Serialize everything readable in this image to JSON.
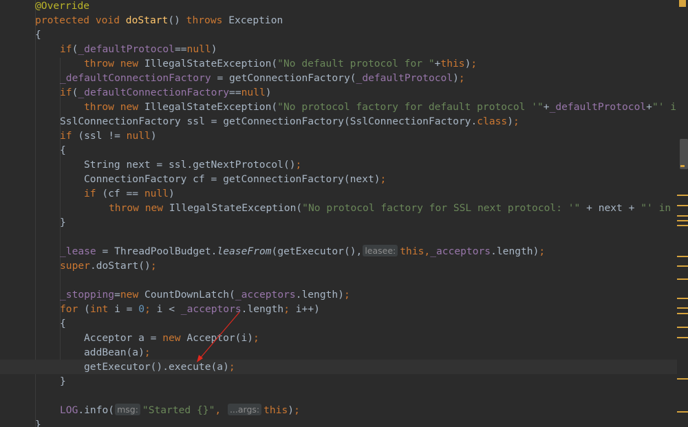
{
  "editor": {
    "lines": {
      "l1": {
        "annotation": "@Override"
      },
      "l2": {
        "kw1": "protected void ",
        "method": "doStart",
        "paren": "() ",
        "kw2": "throws ",
        "rest": "Exception"
      },
      "l3": {
        "text": "{"
      },
      "l4": {
        "kw": "if",
        "a": "(",
        "field": "_defaultProtocol",
        "b": "==",
        "kw2": "null",
        "c": ")"
      },
      "l5": {
        "kw": "throw new ",
        "a": "IllegalStateException(",
        "str": "\"No default protocol for \"",
        "b": "+",
        "kw2": "this",
        "c": ")",
        "semi": ";"
      },
      "l6": {
        "field": "_defaultConnectionFactory",
        "a": " = getConnectionFactory(",
        "field2": "_defaultProtocol",
        "b": ")",
        "semi": ";"
      },
      "l7": {
        "kw": "if",
        "a": "(",
        "field": "_defaultConnectionFactory",
        "b": "==",
        "kw2": "null",
        "c": ")"
      },
      "l8": {
        "kw": "throw new ",
        "a": "IllegalStateException(",
        "str": "\"No protocol factory for default protocol '\"",
        "b": "+",
        "field": "_defaultProtocol",
        "c": "+",
        "str2": "\"' in"
      },
      "l9": {
        "a": "SslConnectionFactory ssl = getConnectionFactory(SslConnectionFactory.",
        "kw": "class",
        "b": ")",
        "semi": ";"
      },
      "l10": {
        "kw": "if",
        "a": " (ssl != ",
        "kw2": "null",
        "b": ")"
      },
      "l11": {
        "text": "{"
      },
      "l12": {
        "a": "String next = ssl.getNextProtocol()",
        "semi": ";"
      },
      "l13": {
        "a": "ConnectionFactory cf = getConnectionFactory(next)",
        "semi": ";"
      },
      "l14": {
        "kw": "if",
        "a": " (cf == ",
        "kw2": "null",
        "b": ")"
      },
      "l15": {
        "kw": "throw new ",
        "a": "IllegalStateException(",
        "str": "\"No protocol factory for SSL next protocol: '\"",
        "b": " + next + ",
        "str2": "\"' in"
      },
      "l16": {
        "text": "}"
      },
      "l18": {
        "field": "_lease",
        "a": " = ThreadPoolBudget.",
        "static": "leaseFrom",
        "b": "(getExecutor(),",
        "hint": "leasee:",
        "kw": "this",
        "c": ",",
        "field2": "_acceptors",
        "d": ".length)",
        "semi": ";"
      },
      "l19": {
        "kw": "super",
        "a": ".doStart()",
        "semi": ";"
      },
      "l21": {
        "field": "_stopping",
        "a": "=",
        "kw": "new ",
        "b": "CountDownLatch(",
        "field2": "_acceptors",
        "c": ".length)",
        "semi": ";"
      },
      "l22": {
        "kw": "for ",
        "a": "(",
        "kw2": "int ",
        "b": "i = ",
        "num": "0",
        "semi1": ";",
        "c": " i < ",
        "field": "_acceptors",
        "d": ".length",
        "semi2": ";",
        "e": " i++)"
      },
      "l23": {
        "text": "{"
      },
      "l24": {
        "a": "Acceptor a = ",
        "kw": "new ",
        "b": "Acceptor(i)",
        "semi": ";"
      },
      "l25": {
        "a": "addBean(a)",
        "semi": ";"
      },
      "l26": {
        "a": "getExecutor().execute(a)",
        "semi": ";"
      },
      "l27": {
        "text": "}"
      },
      "l29": {
        "field": "LOG",
        "a": ".info(",
        "hint1": "msg:",
        "str": "\"Started {}\"",
        "b": ",",
        "hint2": "...args:",
        "kw": "this",
        "c": ")",
        "semi": ";"
      },
      "l30": {
        "text": "}"
      }
    }
  },
  "colors": {
    "background": "#2b2b2b",
    "keyword": "#cc7832",
    "string": "#6a8759",
    "field": "#9876aa",
    "method": "#ffc66d",
    "annotation": "#bbb529",
    "number": "#6897bb",
    "marker": "#d7a43e",
    "arrow": "#e0281e"
  }
}
